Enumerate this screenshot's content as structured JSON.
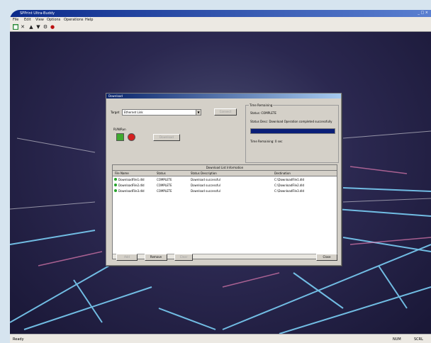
{
  "window": {
    "title": "SPPrint Ultra-Buddy",
    "controls": "_ □ ×",
    "menus": [
      "File",
      "Edit",
      "View",
      "Options",
      "Operations",
      "Help"
    ]
  },
  "toolbar": {
    "icons": [
      "connect-icon",
      "disconnect-icon",
      "upload-icon",
      "download-icon",
      "settings-icon",
      "stop-icon"
    ]
  },
  "statusbar": {
    "left": "Ready",
    "right_1": "NUM",
    "right_2": "SCRL"
  },
  "dialog": {
    "title": "Download",
    "target_label": "Target",
    "target_value": "Ethernet Link",
    "connect_button": "Connect",
    "run_label": "RUN/Run",
    "download_button": "Download",
    "time_group_title": "Time Remaining",
    "status_text": "Status: COMPLETE",
    "status_desc": "Status Desc: Download Operation completed successfully",
    "progress": 1.0,
    "time_remaining": "Time Remaining: 0 sec",
    "table_title": "Download List Information",
    "columns": [
      "File Name",
      "Status",
      "Status Description",
      "Destination"
    ],
    "rows": [
      [
        "DownloadFile1.dld",
        "COMPLETE",
        "Download successful",
        "C:\\DownloadFile1.dld"
      ],
      [
        "DownloadFile2.dld",
        "COMPLETE",
        "Download successful",
        "C:\\DownloadFile2.dld"
      ],
      [
        "DownloadFile3.dld",
        "COMPLETE",
        "Download successful",
        "C:\\DownloadFile3.dld"
      ]
    ],
    "add_button": "Add",
    "remove_button": "Remove",
    "clear_button": "Clear",
    "close_button": "Close"
  }
}
